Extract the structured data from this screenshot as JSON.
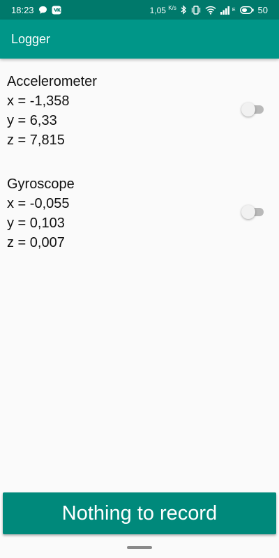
{
  "status_bar": {
    "time": "18:23",
    "net_speed_value": "1,05",
    "net_speed_unit": "K/s",
    "network_type": "E",
    "battery_level": "50",
    "icons": [
      "chat-bubble-icon",
      "vk-icon",
      "bluetooth-icon",
      "vibrate-icon",
      "wifi-icon",
      "signal-icon",
      "battery-icon"
    ]
  },
  "app_bar": {
    "title": "Logger",
    "color": "#009688",
    "status_color": "#00796b"
  },
  "sensors": [
    {
      "name": "Accelerometer",
      "x": "x = -1,358",
      "y": "y = 6,33",
      "z": "z = 7,815",
      "enabled": false
    },
    {
      "name": "Gyroscope",
      "x": "x = -0,055",
      "y": "y = 0,103",
      "z": "z = 0,007",
      "enabled": false
    }
  ],
  "record_button": {
    "label": "Nothing to record",
    "color": "#00897b"
  }
}
